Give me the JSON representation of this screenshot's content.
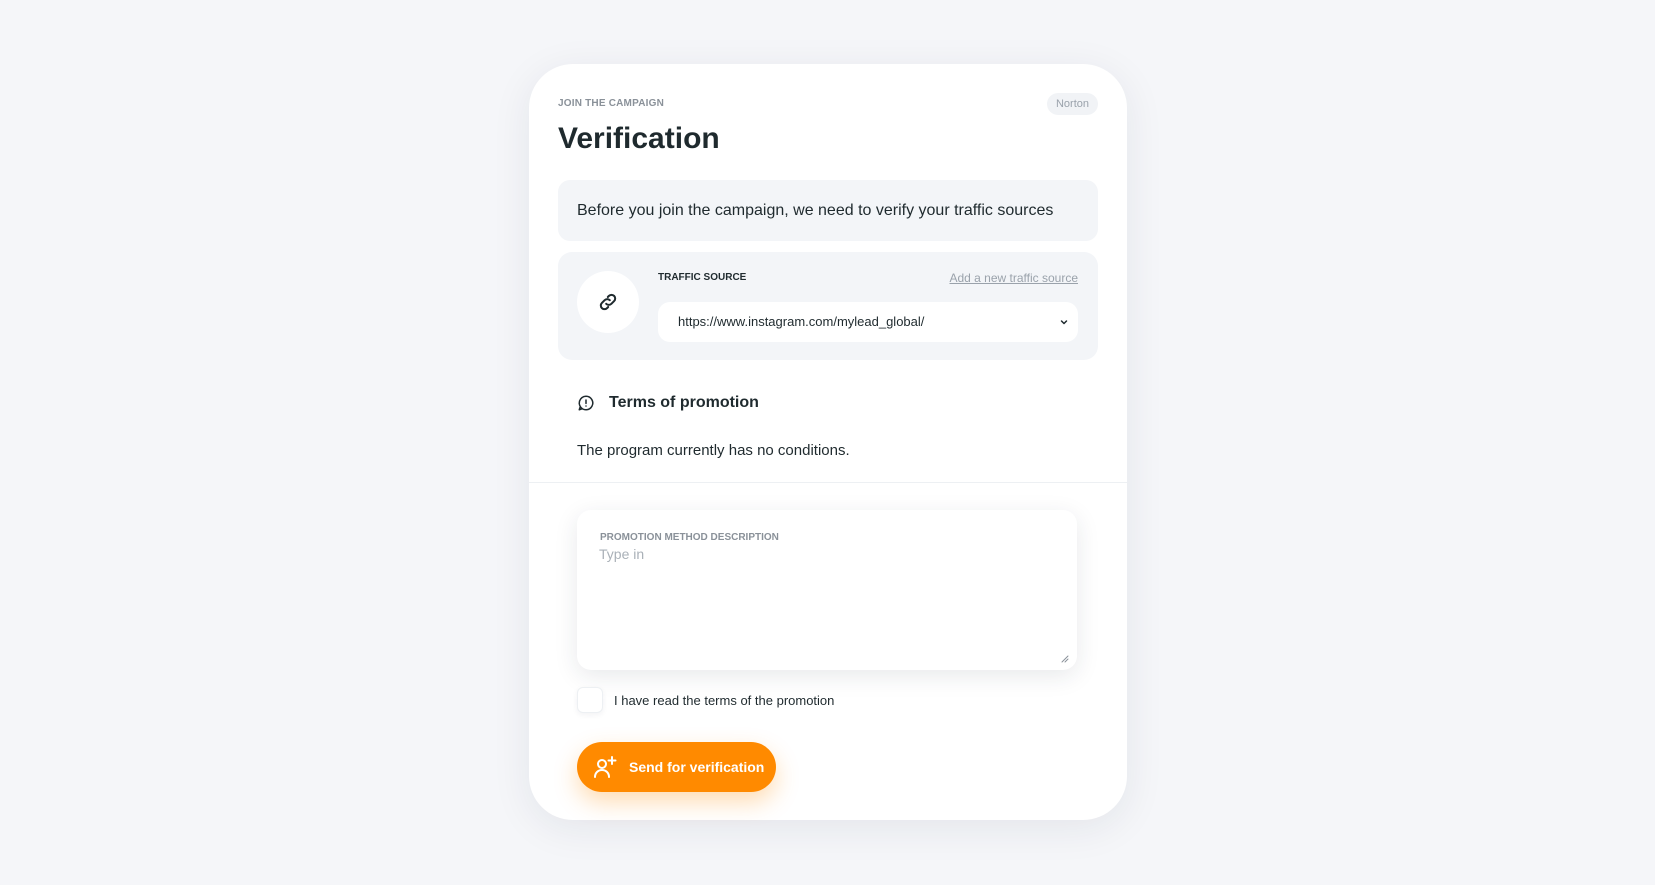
{
  "header": {
    "eyebrow": "JOIN THE CAMPAIGN",
    "badge": "Norton",
    "title": "Verification"
  },
  "info": {
    "text": "Before you join the campaign, we need to verify your traffic sources"
  },
  "traffic_source": {
    "label": "TRAFFIC SOURCE",
    "add_link": "Add a new traffic source",
    "selected": "https://www.instagram.com/mylead_global/",
    "icon": "link-icon"
  },
  "terms": {
    "title": "Terms of promotion",
    "text": "The program currently has no conditions.",
    "icon": "alert-circle-icon"
  },
  "promotion": {
    "label": "PROMOTION METHOD DESCRIPTION",
    "placeholder": "Type in",
    "value": ""
  },
  "agreement": {
    "label": "I have read the terms of the promotion",
    "checked": false
  },
  "submit": {
    "label": "Send for verification",
    "icon": "user-plus-icon"
  },
  "colors": {
    "accent": "#ff8a00",
    "background": "#f5f6f9",
    "card": "#ffffff",
    "text": "#1f2a2e"
  }
}
